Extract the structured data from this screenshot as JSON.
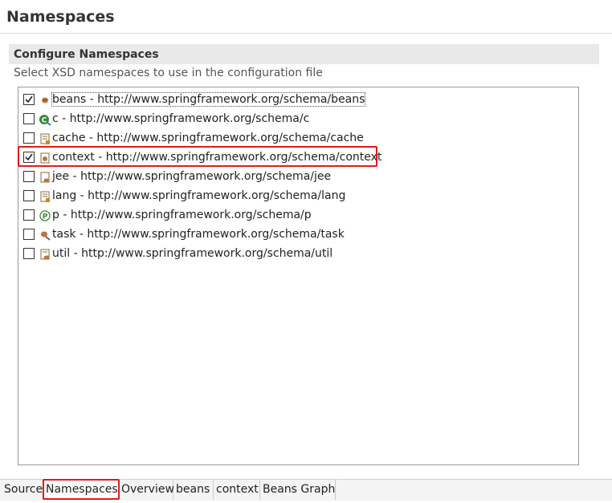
{
  "page": {
    "title": "Namespaces"
  },
  "section": {
    "title": "Configure Namespaces",
    "description": "Select XSD namespaces to use in the configuration file"
  },
  "namespaces": [
    {
      "prefix": "beans",
      "label": "beans - http://www.springframework.org/schema/beans",
      "checked": true,
      "icon": "bean-icon"
    },
    {
      "prefix": "c",
      "label": "c - http://www.springframework.org/schema/c",
      "checked": false,
      "icon": "c-namespace-icon"
    },
    {
      "prefix": "cache",
      "label": "cache - http://www.springframework.org/schema/cache",
      "checked": false,
      "icon": "cache-icon"
    },
    {
      "prefix": "context",
      "label": "context - http://www.springframework.org/schema/context",
      "checked": true,
      "icon": "context-icon"
    },
    {
      "prefix": "jee",
      "label": "jee - http://www.springframework.org/schema/jee",
      "checked": false,
      "icon": "jee-icon"
    },
    {
      "prefix": "lang",
      "label": "lang - http://www.springframework.org/schema/lang",
      "checked": false,
      "icon": "lang-icon"
    },
    {
      "prefix": "p",
      "label": "p - http://www.springframework.org/schema/p",
      "checked": false,
      "icon": "p-namespace-icon"
    },
    {
      "prefix": "task",
      "label": "task - http://www.springframework.org/schema/task",
      "checked": false,
      "icon": "task-icon"
    },
    {
      "prefix": "util",
      "label": "util - http://www.springframework.org/schema/util",
      "checked": false,
      "icon": "util-icon"
    }
  ],
  "tabs": [
    {
      "label": "Source",
      "active": false
    },
    {
      "label": "Namespaces",
      "active": true
    },
    {
      "label": "Overview",
      "active": false
    },
    {
      "label": "beans",
      "active": false
    },
    {
      "label": "context",
      "active": false
    },
    {
      "label": "Beans Graph",
      "active": false
    }
  ],
  "colors": {
    "highlight": "#e01b1b",
    "section_bg": "#e9e9e9"
  }
}
